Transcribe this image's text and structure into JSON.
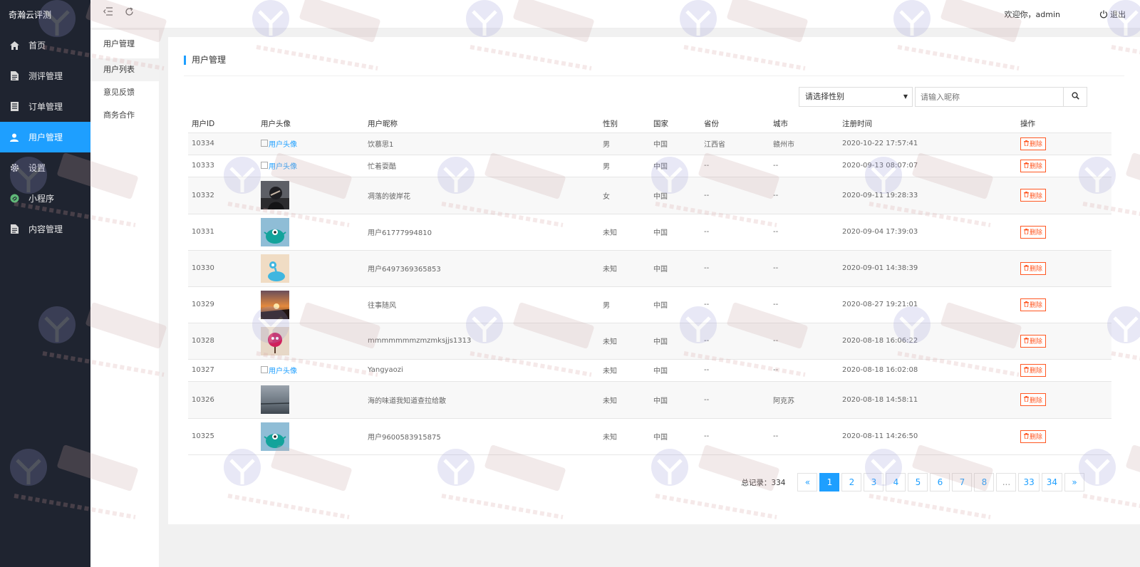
{
  "app": {
    "title": "奇瀚云评测"
  },
  "sidebar": {
    "items": [
      {
        "label": "首页",
        "icon": "home-icon"
      },
      {
        "label": "测评管理",
        "icon": "document-icon"
      },
      {
        "label": "订单管理",
        "icon": "list-icon"
      },
      {
        "label": "用户管理",
        "icon": "user-icon",
        "active": true
      },
      {
        "label": "设置",
        "icon": "gear-icon"
      },
      {
        "label": "小程序",
        "icon": "miniprogram-icon"
      },
      {
        "label": "内容管理",
        "icon": "document-icon"
      }
    ]
  },
  "submenu": {
    "title": "用户管理",
    "items": [
      {
        "label": "用户列表",
        "active": true
      },
      {
        "label": "意见反馈"
      },
      {
        "label": "商务合作"
      }
    ]
  },
  "header": {
    "welcome": "欢迎你，admin",
    "logout": "退出"
  },
  "panel": {
    "title": "用户管理"
  },
  "filter": {
    "gender_select": "请选择性别",
    "search_placeholder": "请输入昵称"
  },
  "table": {
    "columns": [
      "用户ID",
      "用户头像",
      "用户昵称",
      "性别",
      "国家",
      "省份",
      "城市",
      "注册时间",
      "操作"
    ],
    "rows": [
      {
        "id": "10334",
        "avatar": "broken",
        "avatar_alt": "用户头像",
        "nickname": "饮慕思1",
        "gender": "男",
        "country": "中国",
        "province": "江西省",
        "city": "赣州市",
        "registered": "2020-10-22 17:57:41",
        "action": "删除"
      },
      {
        "id": "10333",
        "avatar": "broken",
        "avatar_alt": "用户头像",
        "nickname": "忙着耍酷",
        "gender": "男",
        "country": "中国",
        "province": "--",
        "city": "--",
        "registered": "2020-09-13 08:07:07",
        "action": "删除"
      },
      {
        "id": "10332",
        "avatar": "photo-portrait",
        "nickname": "凋落的彼岸花",
        "gender": "女",
        "country": "中国",
        "province": "--",
        "city": "--",
        "registered": "2020-09-11 19:28:33",
        "action": "删除"
      },
      {
        "id": "10331",
        "avatar": "cartoon-teal",
        "nickname": "用户61777994810",
        "gender": "未知",
        "country": "中国",
        "province": "--",
        "city": "--",
        "registered": "2020-09-04 17:39:03",
        "action": "删除"
      },
      {
        "id": "10330",
        "avatar": "cartoon-blue",
        "nickname": "用户6497369365853",
        "gender": "未知",
        "country": "中国",
        "province": "--",
        "city": "--",
        "registered": "2020-09-01 14:38:39",
        "action": "删除"
      },
      {
        "id": "10329",
        "avatar": "photo-sunset",
        "nickname": "往事随风",
        "gender": "男",
        "country": "中国",
        "province": "--",
        "city": "--",
        "registered": "2020-08-27 19:21:01",
        "action": "删除"
      },
      {
        "id": "10328",
        "avatar": "cartoon-pink",
        "nickname": "mmmmmmmzmzmksjjs1313",
        "gender": "未知",
        "country": "中国",
        "province": "--",
        "city": "--",
        "registered": "2020-08-18 16:06:22",
        "action": "删除"
      },
      {
        "id": "10327",
        "avatar": "broken",
        "avatar_alt": "用户头像",
        "nickname": "Yangyaozi",
        "gender": "未知",
        "country": "中国",
        "province": "--",
        "city": "--",
        "registered": "2020-08-18 16:02:08",
        "action": "删除"
      },
      {
        "id": "10326",
        "avatar": "photo-sea",
        "nickname": "海的味道我知道查拉给散",
        "gender": "未知",
        "country": "中国",
        "province": "--",
        "city": "阿克苏",
        "registered": "2020-08-18 14:58:11",
        "action": "删除"
      },
      {
        "id": "10325",
        "avatar": "cartoon-teal",
        "nickname": "用户9600583915875",
        "gender": "未知",
        "country": "中国",
        "province": "--",
        "city": "--",
        "registered": "2020-08-11 14:26:50",
        "action": "删除"
      }
    ]
  },
  "pagination": {
    "total_label": "总记录：334",
    "prev": "«",
    "next": "»",
    "pages": [
      "1",
      "2",
      "3",
      "4",
      "5",
      "6",
      "7",
      "8",
      "...",
      "33",
      "34"
    ],
    "current": "1"
  },
  "colors": {
    "accent": "#1e9fff",
    "sidebar_bg": "#1f2430",
    "danger": "#ff5722"
  }
}
